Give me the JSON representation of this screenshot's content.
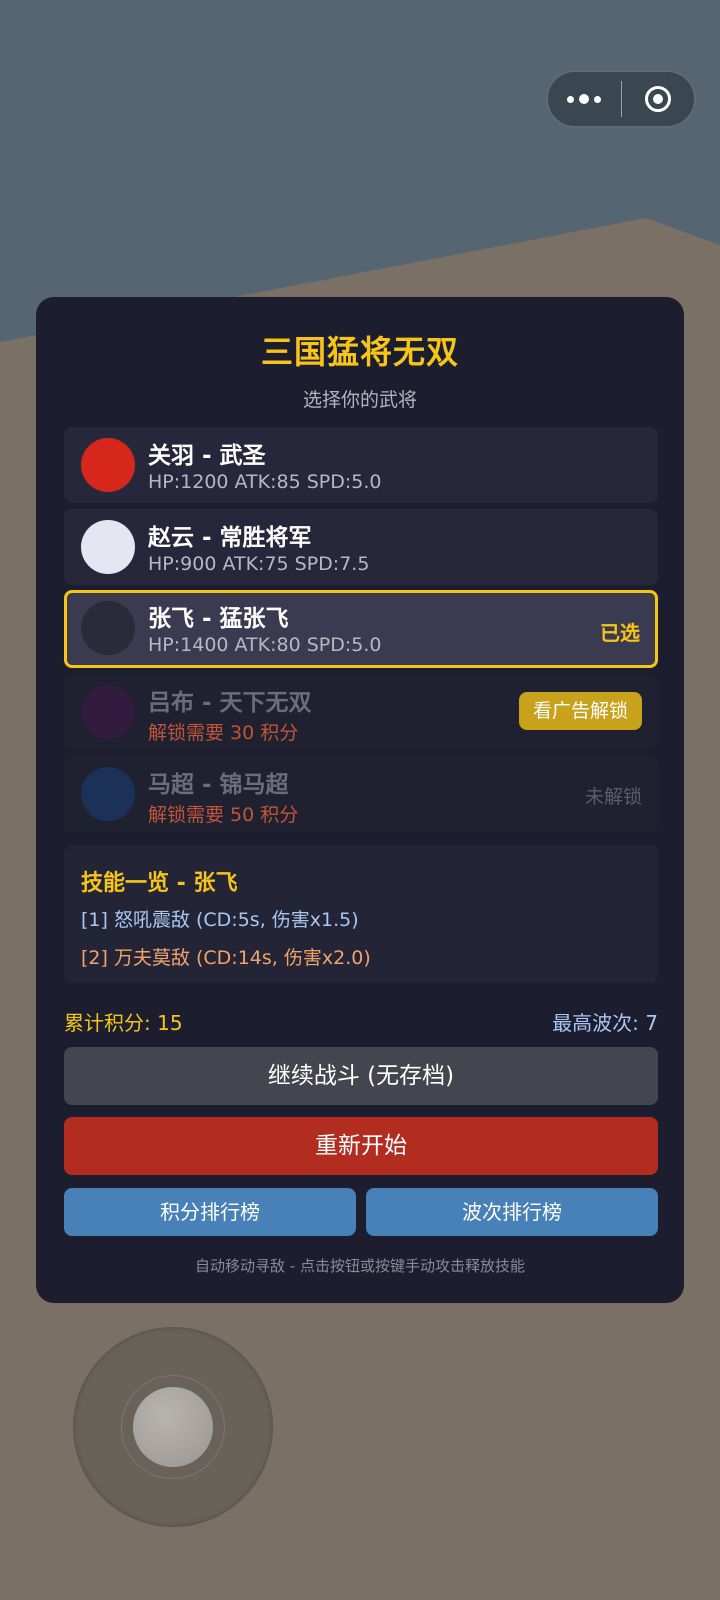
{
  "title": "三国猛将无双",
  "subtitle": "选择你的武将",
  "heroes": [
    {
      "name": "关羽 - 武圣",
      "stats": "HP:1200 ATK:85 SPD:5.0",
      "color": "#d7261b"
    },
    {
      "name": "赵云 - 常胜将军",
      "stats": "HP:900 ATK:75 SPD:7.5",
      "color": "#e6e6f2"
    },
    {
      "name": "张飞 - 猛张飞",
      "stats": "HP:1400 ATK:80 SPD:5.0",
      "color": "#2a2b38",
      "tag": "已选"
    },
    {
      "name": "吕布 - 天下无双",
      "stats": "解锁需要 30 积分",
      "color": "#321b3f",
      "action": "看广告解锁"
    },
    {
      "name": "马超 - 锦马超",
      "stats": "解锁需要 50 积分",
      "color": "#1b3157",
      "tag": "未解锁"
    }
  ],
  "skills": {
    "title": "技能一览 - 张飞",
    "items": [
      "[1] 怒吼震敌 (CD:5s, 伤害x1.5)",
      "[2] 万夫莫敌 (CD:14s, 伤害x2.0)"
    ]
  },
  "score_text": "累计积分: 15",
  "wave_text": "最高波次: 7",
  "buttons": {
    "continue": "继续战斗 (无存档)",
    "restart": "重新开始",
    "score_rank": "积分排行榜",
    "wave_rank": "波次排行榜"
  },
  "hint": "自动移动寻敌 - 点击按钮或按键手动攻击释放技能",
  "capsule_icons": [
    "more-dots-icon",
    "close-target-icon"
  ]
}
